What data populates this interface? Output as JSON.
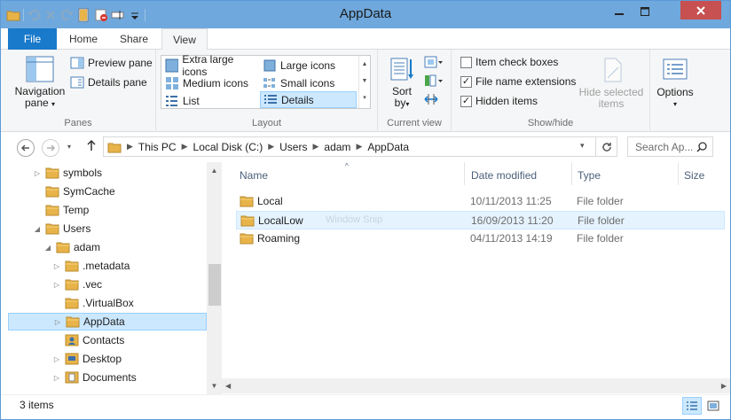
{
  "window": {
    "title": "AppData"
  },
  "quick_access": {
    "icons": [
      "folder-icon",
      "undo-icon",
      "redo-icon",
      "redo-icon",
      "folder-open-icon",
      "properties-icon",
      "rename-icon",
      "customize-dropdown-icon"
    ]
  },
  "tabs": {
    "file": "File",
    "home": "Home",
    "share": "Share",
    "view": "View"
  },
  "ribbon": {
    "panes": {
      "navigation_pane": "Navigation",
      "navigation_pane_2": "pane",
      "preview_pane": "Preview pane",
      "details_pane": "Details pane",
      "group_label": "Panes"
    },
    "layout": {
      "extra_large": "Extra large icons",
      "large": "Large icons",
      "medium": "Medium icons",
      "small": "Small icons",
      "list": "List",
      "details": "Details",
      "group_label": "Layout"
    },
    "current_view": {
      "sort_by": "Sort",
      "sort_by_2": "by",
      "group_label": "Current view"
    },
    "show_hide": {
      "item_check_boxes": "Item check boxes",
      "file_name_extensions": "File name extensions",
      "hidden_items": "Hidden items",
      "hide_selected": "Hide selected",
      "hide_selected_2": "items",
      "group_label": "Show/hide",
      "item_check_boxes_checked": false,
      "file_name_extensions_checked": true,
      "hidden_items_checked": true
    },
    "options": {
      "label": "Options"
    }
  },
  "address": {
    "crumbs": [
      "This PC",
      "Local Disk (C:)",
      "Users",
      "adam",
      "AppData"
    ],
    "search_placeholder": "Search Ap..."
  },
  "tree": [
    {
      "label": "symbols",
      "expander": "▷"
    },
    {
      "label": "SymCache",
      "expander": ""
    },
    {
      "label": "Temp",
      "expander": ""
    },
    {
      "label": "Users",
      "expander": "◢"
    },
    {
      "label": "adam",
      "expander": "◢"
    },
    {
      "label": ".metadata",
      "expander": "▷"
    },
    {
      "label": ".vec",
      "expander": "▷"
    },
    {
      "label": ".VirtualBox",
      "expander": ""
    },
    {
      "label": "AppData",
      "expander": "▷"
    },
    {
      "label": "Contacts",
      "expander": ""
    },
    {
      "label": "Desktop",
      "expander": "▷"
    },
    {
      "label": "Documents",
      "expander": "▷"
    }
  ],
  "columns": {
    "name": "Name",
    "date": "Date modified",
    "type": "Type",
    "size": "Size"
  },
  "files": [
    {
      "name": "Local",
      "date": "10/11/2013 11:25",
      "type": "File folder"
    },
    {
      "name": "LocalLow",
      "date": "16/09/2013 11:20",
      "type": "File folder",
      "overlay": "Window Snip"
    },
    {
      "name": "Roaming",
      "date": "04/11/2013 14:19",
      "type": "File folder"
    }
  ],
  "status": {
    "count": "3 items"
  },
  "colors": {
    "titlebar": "#6fa8dc",
    "file_tab": "#1979ca",
    "selection": "#cce8ff",
    "folder": "#e8b44a"
  }
}
